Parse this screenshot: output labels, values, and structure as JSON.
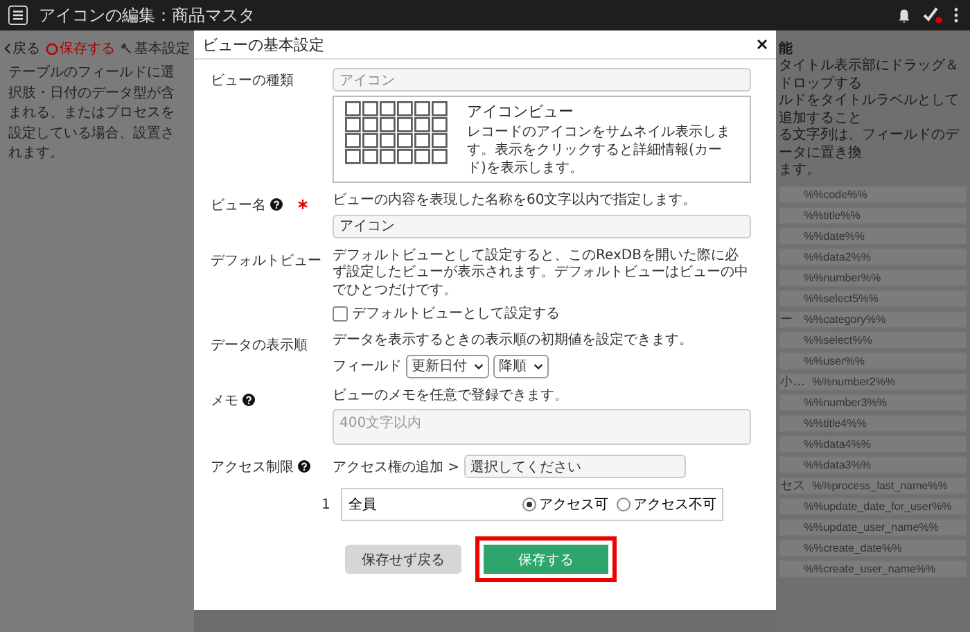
{
  "app_bar": {
    "title": "アイコンの編集：商品マスタ"
  },
  "toolbar": [
    {
      "label": "戻る",
      "kind": "back"
    },
    {
      "label": "保存する",
      "kind": "save"
    },
    {
      "label": "基本設定",
      "kind": "settings"
    }
  ],
  "left_panel": {
    "text": "テーブルのフィールドに選択肢・日付のデータ型が含まれる、またはプロセスを設定している場合、設置されます。"
  },
  "right_panel": {
    "heading": "能",
    "lines": [
      "タイトル表示部にドラッグ＆ドロップする",
      "ルドをタイトルラベルとして追加すること",
      "る文字列は、フィールドのデータに置き換",
      "ます。"
    ],
    "rows": [
      {
        "token": "%%code%%"
      },
      {
        "token": "%%title%%"
      },
      {
        "token": "%%date%%"
      },
      {
        "token": "%%data2%%"
      },
      {
        "token": "%%number%%"
      },
      {
        "token": "%%select5%%"
      },
      {
        "label": "ー",
        "token": "%%category%%"
      },
      {
        "token": "%%select%%"
      },
      {
        "token": "%%user%%"
      },
      {
        "label": "小…",
        "token": "%%number2%%"
      },
      {
        "token": "%%number3%%"
      },
      {
        "token": "%%title4%%"
      },
      {
        "token": "%%data4%%"
      },
      {
        "token": "%%data3%%"
      },
      {
        "label": "セス",
        "token": "%%process_last_name%%"
      },
      {
        "token": "%%update_date_for_user%%"
      },
      {
        "token": "%%update_user_name%%"
      },
      {
        "token": "%%create_date%%"
      },
      {
        "token": "%%create_user_name%%"
      }
    ]
  },
  "dialog": {
    "title": "ビューの基本設定",
    "view_type": {
      "label": "ビューの種類",
      "value": "アイコン",
      "preview_title": "アイコンビュー",
      "preview_description": "レコードのアイコンをサムネイル表示します。表示をクリックすると詳細情報(カード)を表示します。"
    },
    "view_name": {
      "label": "ビュー名",
      "has_help": true,
      "required": true,
      "help": "ビューの内容を表現した名称を60文字以内で指定します。",
      "value": "アイコン"
    },
    "default_view": {
      "label": "デフォルトビュー",
      "help": "デフォルトビューとして設定すると、このRexDBを開いた際に必ず設定したビューが表示されます。デフォルトビューはビューの中でひとつだけです。",
      "checkbox_label": "デフォルトビューとして設定する",
      "checked": false
    },
    "sort_order": {
      "label": "データの表示順",
      "help": "データを表示するときの表示順の初期値を設定できます。",
      "field_label": "フィールド",
      "field_value": "更新日付",
      "direction_value": "降順"
    },
    "memo": {
      "label": "メモ",
      "has_help": true,
      "help": "ビューのメモを任意で登録できます。",
      "placeholder": "400文字以内"
    },
    "access": {
      "label": "アクセス制限",
      "has_help": true,
      "add_label": "アクセス権の追加 >",
      "select_value": "選択してください",
      "entries": [
        {
          "index": "1",
          "name": "全員",
          "options": [
            {
              "label": "アクセス可",
              "selected": true
            },
            {
              "label": "アクセス不可",
              "selected": false
            }
          ]
        }
      ]
    },
    "buttons": [
      {
        "label": "保存せず戻る",
        "kind": "secondary",
        "highlighted": false
      },
      {
        "label": "保存する",
        "kind": "primary",
        "highlighted": true
      }
    ]
  }
}
